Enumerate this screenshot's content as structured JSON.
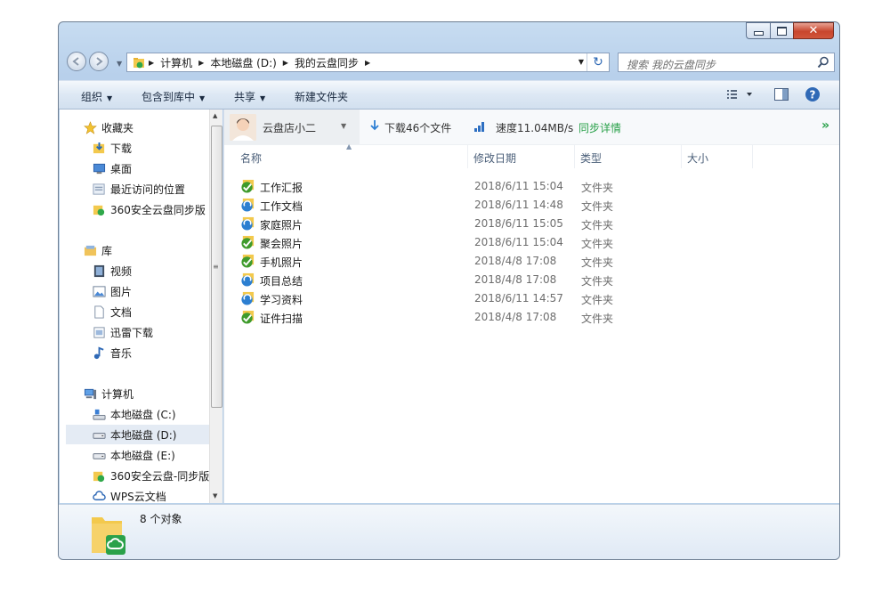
{
  "window": {
    "caption_buttons": {
      "minimize": "—",
      "maximize": "□",
      "close": "✕"
    }
  },
  "address": {
    "crumbs": [
      "计算机",
      "本地磁盘 (D:)",
      "我的云盘同步"
    ],
    "search_placeholder": "搜索 我的云盘同步"
  },
  "toolbar": {
    "organize": "组织",
    "include_in_library": "包含到库中",
    "share": "共享",
    "new_folder": "新建文件夹"
  },
  "nav": {
    "favorites": {
      "label": "收藏夹",
      "items": [
        {
          "label": "下载",
          "icon": "download-folder-icon"
        },
        {
          "label": "桌面",
          "icon": "desktop-icon"
        },
        {
          "label": "最近访问的位置",
          "icon": "recent-places-icon"
        },
        {
          "label": "360安全云盘同步版",
          "icon": "cloud-sync-icon"
        }
      ]
    },
    "libraries": {
      "label": "库",
      "items": [
        {
          "label": "视频",
          "icon": "video-library-icon"
        },
        {
          "label": "图片",
          "icon": "pictures-library-icon"
        },
        {
          "label": "文档",
          "icon": "documents-library-icon"
        },
        {
          "label": "迅雷下载",
          "icon": "thunder-download-icon"
        },
        {
          "label": "音乐",
          "icon": "music-library-icon"
        }
      ]
    },
    "computer": {
      "label": "计算机",
      "items": [
        {
          "label": "本地磁盘 (C:)",
          "icon": "system-drive-icon"
        },
        {
          "label": "本地磁盘 (D:)",
          "icon": "drive-icon",
          "selected": true
        },
        {
          "label": "本地磁盘 (E:)",
          "icon": "drive-icon"
        },
        {
          "label": "360安全云盘-同步版",
          "icon": "cloud-sync-icon"
        },
        {
          "label": "WPS云文档",
          "icon": "wps-cloud-icon"
        }
      ]
    }
  },
  "cloud_bar": {
    "account_name": "云盘店小二",
    "download_status": "下载46个文件",
    "speed": "速度11.04MB/s",
    "sync_details": "同步详情",
    "more": "»"
  },
  "columns": {
    "name": "名称",
    "modified": "修改日期",
    "type": "类型",
    "size": "大小"
  },
  "files": [
    {
      "name": "工作汇报",
      "modified": "2018/6/11 15:04",
      "type": "文件夹",
      "status": "synced"
    },
    {
      "name": "工作文档",
      "modified": "2018/6/11 14:48",
      "type": "文件夹",
      "status": "syncing"
    },
    {
      "name": "家庭照片",
      "modified": "2018/6/11 15:05",
      "type": "文件夹",
      "status": "syncing"
    },
    {
      "name": "聚会照片",
      "modified": "2018/6/11 15:04",
      "type": "文件夹",
      "status": "synced"
    },
    {
      "name": "手机照片",
      "modified": "2018/4/8 17:08",
      "type": "文件夹",
      "status": "synced"
    },
    {
      "name": "项目总结",
      "modified": "2018/4/8 17:08",
      "type": "文件夹",
      "status": "syncing"
    },
    {
      "name": "学习资料",
      "modified": "2018/6/11 14:57",
      "type": "文件夹",
      "status": "syncing"
    },
    {
      "name": "证件扫描",
      "modified": "2018/4/8 17:08",
      "type": "文件夹",
      "status": "synced"
    }
  ],
  "details": {
    "count": "8 个对象"
  },
  "colors": {
    "synced": "#3f9b2c",
    "syncing": "#2c7fd1",
    "accent_link": "#2aa14a",
    "speed_bars": "#2d6fc2"
  }
}
